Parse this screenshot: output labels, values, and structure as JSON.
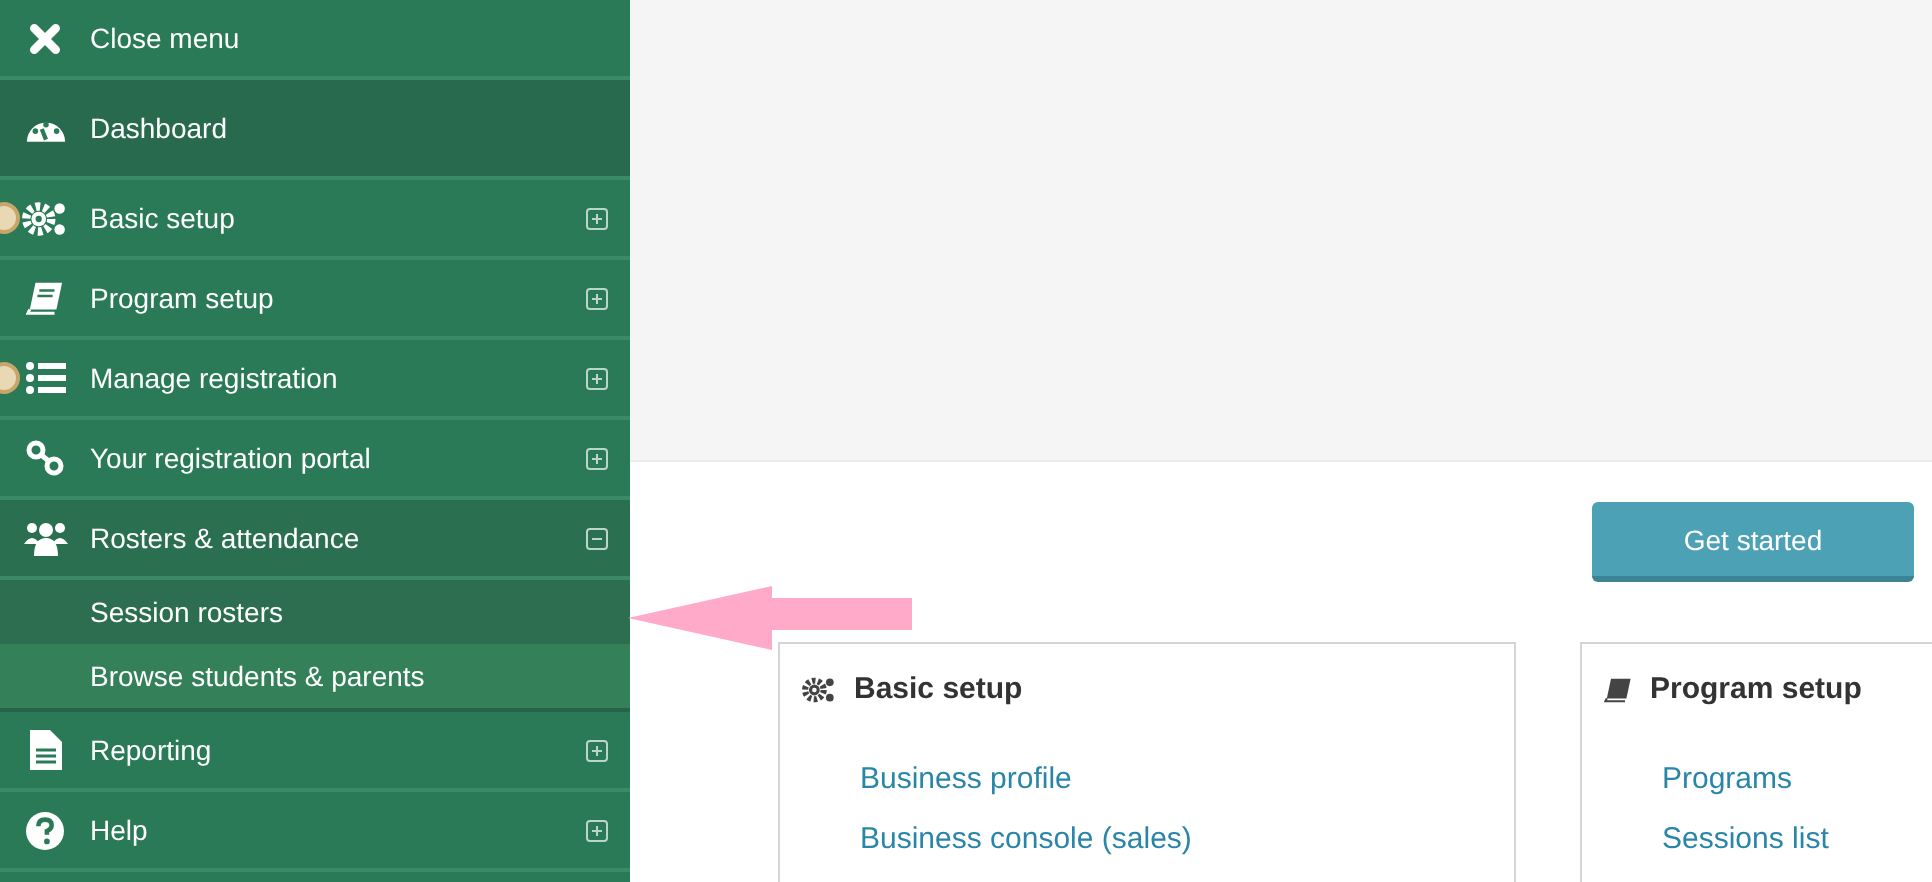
{
  "sidebar": {
    "close": {
      "label": "Close menu"
    },
    "items": [
      {
        "label": "Dashboard",
        "selected": true,
        "marker": false
      },
      {
        "label": "Basic setup",
        "selected": false,
        "marker": true,
        "expanded": false
      },
      {
        "label": "Program setup",
        "selected": false,
        "marker": false,
        "expanded": false
      },
      {
        "label": "Manage registration",
        "selected": false,
        "marker": true,
        "expanded": false
      },
      {
        "label": "Your registration portal",
        "selected": false,
        "marker": false,
        "expanded": false
      },
      {
        "label": "Rosters & attendance",
        "selected": false,
        "marker": false,
        "expanded": true,
        "children": [
          {
            "label": "Session rosters",
            "selected": true
          },
          {
            "label": "Browse students & parents",
            "selected": false
          }
        ]
      },
      {
        "label": "Reporting",
        "selected": false,
        "marker": false,
        "expanded": false
      },
      {
        "label": "Help",
        "selected": false,
        "marker": false,
        "expanded": false
      }
    ]
  },
  "main": {
    "button": "Get started",
    "cards": [
      {
        "title": "Basic setup",
        "links": [
          "Business profile",
          "Business console (sales)"
        ]
      },
      {
        "title": "Program setup",
        "links": [
          "Programs",
          "Sessions list"
        ]
      }
    ]
  }
}
